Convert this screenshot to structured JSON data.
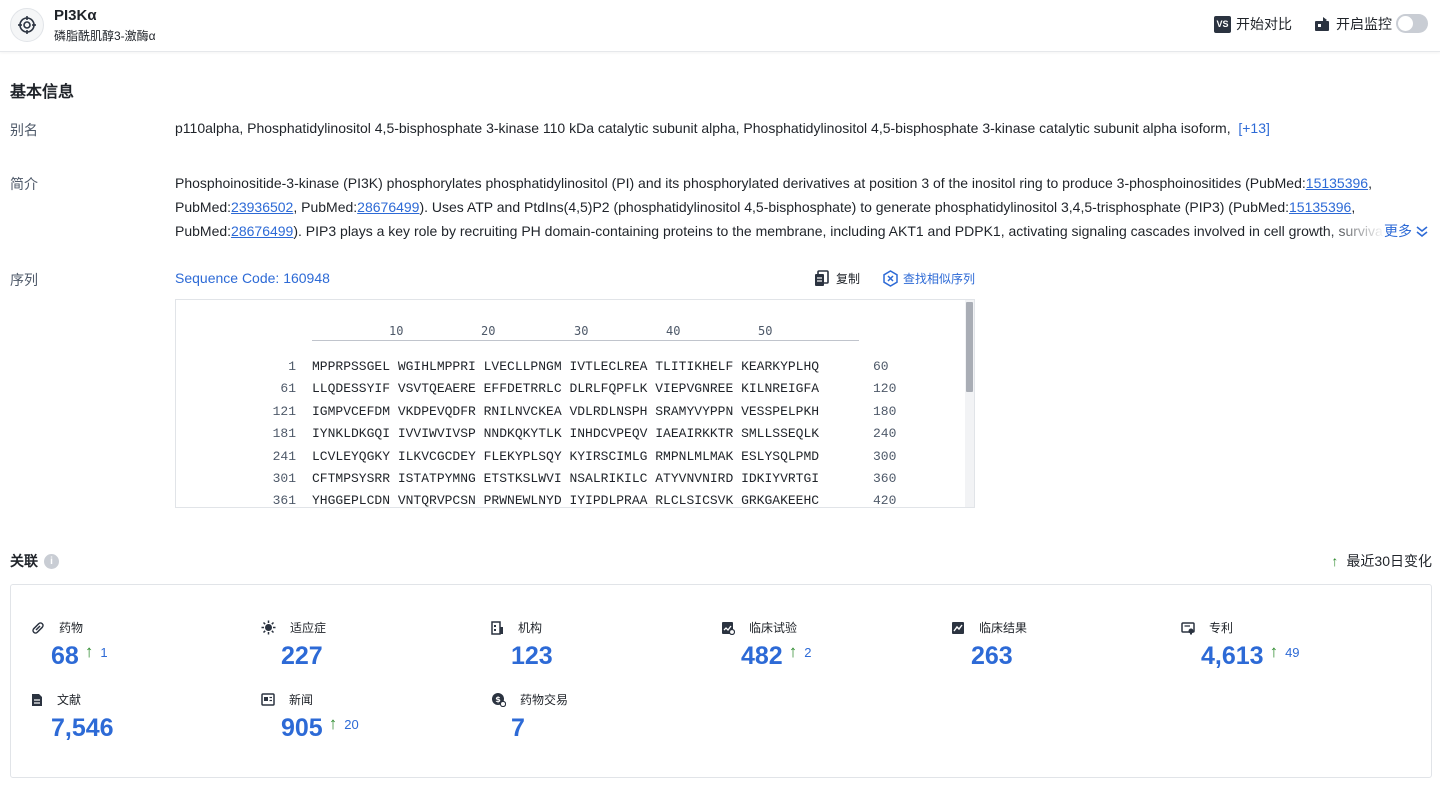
{
  "header": {
    "title": "PI3Kα",
    "subtitle": "磷脂酰肌醇3-激酶α",
    "compare_label": "开始对比",
    "compare_icon_text": "VS",
    "monitor_label": "开启监控"
  },
  "basic_info": {
    "section_title": "基本信息",
    "alias_label": "别名",
    "aliases": "p110alpha,  Phosphatidylinositol 4,5-bisphosphate 3-kinase 110 kDa catalytic subunit alpha,  Phosphatidylinositol 4,5-bisphosphate 3-kinase catalytic subunit alpha isoform,",
    "aliases_more": "[+13]",
    "summary_label": "简介",
    "summary": {
      "p1": "Phosphoinositide-3-kinase (PI3K) phosphorylates phosphatidylinositol (PI) and its phosphorylated derivatives at position 3 of the inositol ring to produce 3-phosphoinositides (PubMed:",
      "link1": "15135396",
      "p2": ", PubMed:",
      "link2": "23936502",
      "p3": ", PubMed:",
      "link3": "28676499",
      "p4": "). Uses ATP and PtdIns(4,5)P2 (phosphatidylinositol 4,5-bisphosphate) to generate phosphatidylinositol 3,4,5-trisphosphate (PIP3) (PubMed:",
      "link4": "15135396",
      "p5": ", PubMed:",
      "link5": "28676499",
      "p6": "). PIP3 plays a key role by recruiting PH domain-containing proteins to the membrane, including AKT1 and PDPK1, activating signaling cascades involved in cell growth, survival, proliferation, motility and morphology."
    },
    "more_label": "更多",
    "sequence_label": "序列",
    "sequence_code": "Sequence Code: 160948",
    "copy_label": "复制",
    "find_similar_label": "查找相似序列",
    "ruler": [
      "10",
      "20",
      "30",
      "40",
      "50"
    ],
    "sequence_rows": [
      {
        "start": "1",
        "blocks": "MPPRPSSGEL WGIHLMPPRI LVECLLPNGM IVTLECLREA TLITIKHELF KEARKYPLHQ",
        "end": "60"
      },
      {
        "start": "61",
        "blocks": "LLQDESSYIF VSVTQEAERE EFFDETRRLC DLRLFQPFLK VIEPVGNREE KILNREIGFA",
        "end": "120"
      },
      {
        "start": "121",
        "blocks": "IGMPVCEFDM VKDPEVQDFR RNILNVCKEA VDLRDLNSPH SRAMYVYPPN VESSPELPKH",
        "end": "180"
      },
      {
        "start": "181",
        "blocks": "IYNKLDKGQI IVVIWVIVSP NNDKQKYTLK INHDCVPEQV IAEAIRKKTR SMLLSSEQLK",
        "end": "240"
      },
      {
        "start": "241",
        "blocks": "LCVLEYQGKY ILKVCGCDEY FLEKYPLSQY KYIRSCIMLG RMPNLMLMAK ESLYSQLPMD",
        "end": "300"
      },
      {
        "start": "301",
        "blocks": "CFTMPSYSRR ISTATPYMNG ETSTKSLWVI NSALRIKILC ATYVNVNIRD IDKIYVRTGI",
        "end": "360"
      },
      {
        "start": "361",
        "blocks": "YHGGEPLCDN VNTQRVPCSN PRWNEWLNYD IYIPDLPRAA RLCLSICSVK GRKGAKEEHC",
        "end": "420"
      }
    ]
  },
  "relations": {
    "title": "关联",
    "info_icon_text": "i",
    "change_arrow": "↑",
    "change_label": "最近30日变化",
    "items": [
      {
        "key": "drugs",
        "label": "药物",
        "value": "68",
        "delta": "1"
      },
      {
        "key": "indications",
        "label": "适应症",
        "value": "227",
        "delta": ""
      },
      {
        "key": "organizations",
        "label": "机构",
        "value": "123",
        "delta": ""
      },
      {
        "key": "clinical-trials",
        "label": "临床试验",
        "value": "482",
        "delta": "2"
      },
      {
        "key": "clinical-results",
        "label": "临床结果",
        "value": "263",
        "delta": ""
      },
      {
        "key": "patents",
        "label": "专利",
        "value": "4,613",
        "delta": "49"
      },
      {
        "key": "literature",
        "label": "文献",
        "value": "7,546",
        "delta": ""
      },
      {
        "key": "news",
        "label": "新闻",
        "value": "905",
        "delta": "20"
      },
      {
        "key": "drug-deals",
        "label": "药物交易",
        "value": "7",
        "delta": ""
      }
    ]
  }
}
